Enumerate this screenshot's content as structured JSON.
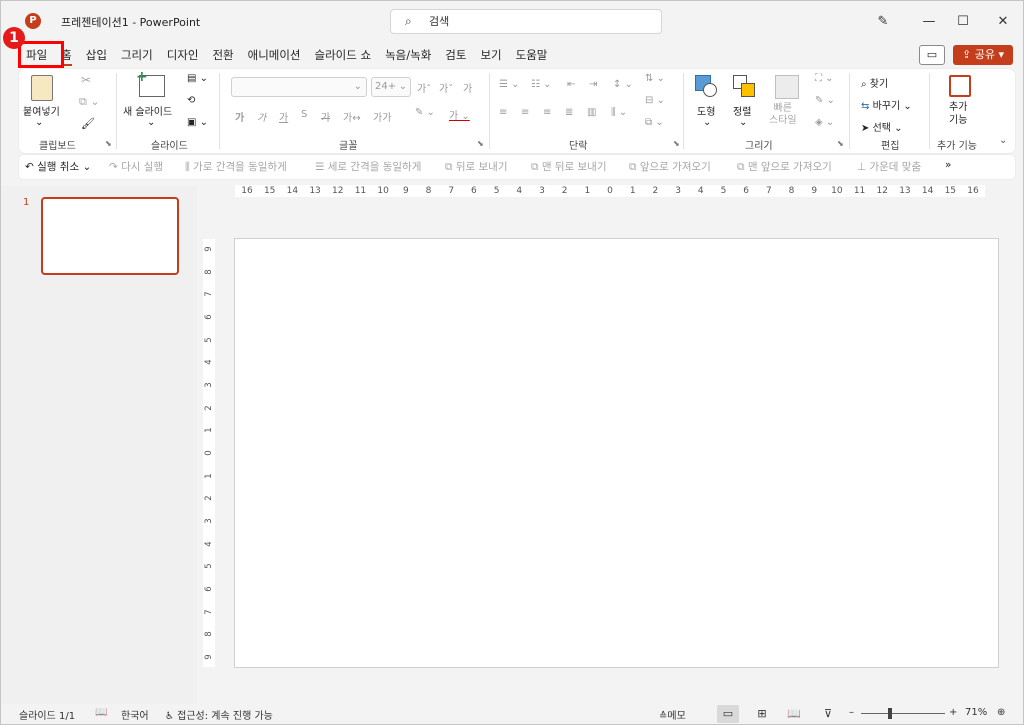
{
  "titlebar": {
    "logo_letter": "P",
    "doc_title": "프레젠테이션1  -  PowerPoint",
    "search_placeholder": "검색",
    "designer_icon": "pen-sparkle-icon",
    "minimize": "—",
    "maximize": "☐",
    "close": "✕"
  },
  "step_badge": "1",
  "tabs": [
    "파일",
    "홈",
    "삽입",
    "그리기",
    "디자인",
    "전환",
    "애니메이션",
    "슬라이드 쇼",
    "녹음/녹화",
    "검토",
    "보기",
    "도움말"
  ],
  "share": {
    "comment_icon": "comment-icon",
    "label": "공유"
  },
  "ribbon": {
    "clipboard": {
      "paste": "붙여넣기",
      "label": "클립보드"
    },
    "slides": {
      "new_slide": "새 슬라이드",
      "label": "슬라이드"
    },
    "font": {
      "size": "24+",
      "grow": "가ˆ",
      "shrink": "가ˇ",
      "clear": "가",
      "bold": "가",
      "italic": "가",
      "underline": "가",
      "strike": "가",
      "spacing": "가↔",
      "case": "가가",
      "label": "글꼴"
    },
    "paragraph": {
      "label": "단락"
    },
    "drawing": {
      "shapes": "도형",
      "arrange": "정렬",
      "quick_styles": "빠른\n스타일",
      "label": "그리기"
    },
    "editing": {
      "find": "찾기",
      "replace": "바꾸기",
      "select": "선택",
      "label": "편집"
    },
    "addins": {
      "addins": "추가\n기능",
      "label": "추가 기능"
    }
  },
  "qat": {
    "undo": "실행 취소",
    "redo": "다시 실행",
    "dist_h": "가로 간격을 동일하게",
    "dist_v": "세로 간격을 동일하게",
    "send_backward": "뒤로 보내기",
    "send_back": "맨 뒤로 보내기",
    "bring_forward": "앞으로 가져오기",
    "bring_front": "맨 앞으로 가져오기",
    "center": "가운데 맞춤",
    "more": "»"
  },
  "thumbnails": [
    {
      "number": "1"
    }
  ],
  "ruler_h": [
    "16",
    "15",
    "14",
    "13",
    "12",
    "11",
    "10",
    "9",
    "8",
    "7",
    "6",
    "5",
    "4",
    "3",
    "2",
    "1",
    "0",
    "1",
    "2",
    "3",
    "4",
    "5",
    "6",
    "7",
    "8",
    "9",
    "10",
    "11",
    "12",
    "13",
    "14",
    "15",
    "16"
  ],
  "ruler_v": [
    "9",
    "8",
    "7",
    "6",
    "5",
    "4",
    "3",
    "2",
    "1",
    "0",
    "1",
    "2",
    "3",
    "4",
    "5",
    "6",
    "7",
    "8",
    "9"
  ],
  "status": {
    "slide": "슬라이드 1/1",
    "language": "한국어",
    "accessibility": "접근성: 계속 진행 가능",
    "notes": "메모",
    "zoom_minus": "–",
    "zoom_plus": "+",
    "zoom": "71%",
    "zoom_level": 0.35
  },
  "colors": {
    "accent": "#c43e1c",
    "highlight": "#ff0000"
  }
}
